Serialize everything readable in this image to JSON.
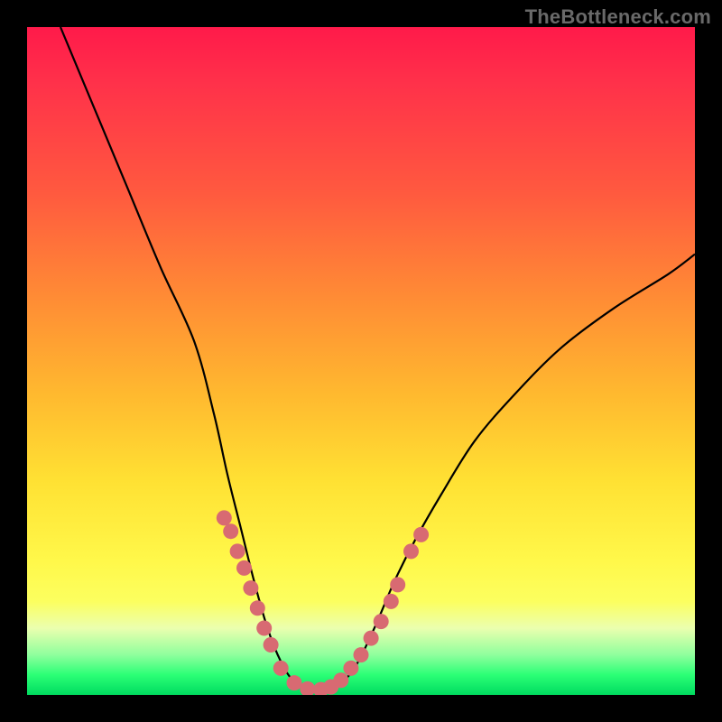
{
  "watermark": "TheBottleneck.com",
  "chart_data": {
    "type": "line",
    "title": "",
    "xlabel": "",
    "ylabel": "",
    "xlim": [
      0,
      100
    ],
    "ylim": [
      0,
      100
    ],
    "background": "gradient-red-yellow-green",
    "curve_left": {
      "description": "descending branch, high at left edge to valley",
      "points_xy": [
        [
          5,
          100
        ],
        [
          10,
          88
        ],
        [
          15,
          76
        ],
        [
          20,
          64
        ],
        [
          25,
          53
        ],
        [
          28,
          42
        ],
        [
          30,
          33
        ],
        [
          32,
          25
        ],
        [
          34,
          17
        ],
        [
          36,
          10
        ],
        [
          38,
          5
        ],
        [
          40,
          2
        ],
        [
          43,
          0.5
        ]
      ]
    },
    "curve_right": {
      "description": "ascending branch, valley rising to right",
      "points_xy": [
        [
          43,
          0.5
        ],
        [
          46,
          1
        ],
        [
          49,
          4
        ],
        [
          52,
          10
        ],
        [
          55,
          17
        ],
        [
          58,
          23
        ],
        [
          62,
          30
        ],
        [
          67,
          38
        ],
        [
          73,
          45
        ],
        [
          80,
          52
        ],
        [
          88,
          58
        ],
        [
          96,
          63
        ],
        [
          100,
          66
        ]
      ]
    },
    "markers_xy": [
      [
        29.5,
        26.5
      ],
      [
        30.5,
        24.5
      ],
      [
        31.5,
        21.5
      ],
      [
        32.5,
        19.0
      ],
      [
        33.5,
        16.0
      ],
      [
        34.5,
        13.0
      ],
      [
        35.5,
        10.0
      ],
      [
        36.5,
        7.5
      ],
      [
        38.0,
        4.0
      ],
      [
        40.0,
        1.8
      ],
      [
        42.0,
        0.9
      ],
      [
        44.0,
        0.8
      ],
      [
        45.5,
        1.2
      ],
      [
        47.0,
        2.2
      ],
      [
        48.5,
        4.0
      ],
      [
        50.0,
        6.0
      ],
      [
        51.5,
        8.5
      ],
      [
        53.0,
        11.0
      ],
      [
        54.5,
        14.0
      ],
      [
        55.5,
        16.5
      ],
      [
        57.5,
        21.5
      ],
      [
        59.0,
        24.0
      ]
    ],
    "marker_radius": 8.5,
    "colors": {
      "curve": "#000000",
      "marker_fill": "#d86a72",
      "gradient_top": "#ff1a4a",
      "gradient_bottom": "#00db5f"
    }
  }
}
